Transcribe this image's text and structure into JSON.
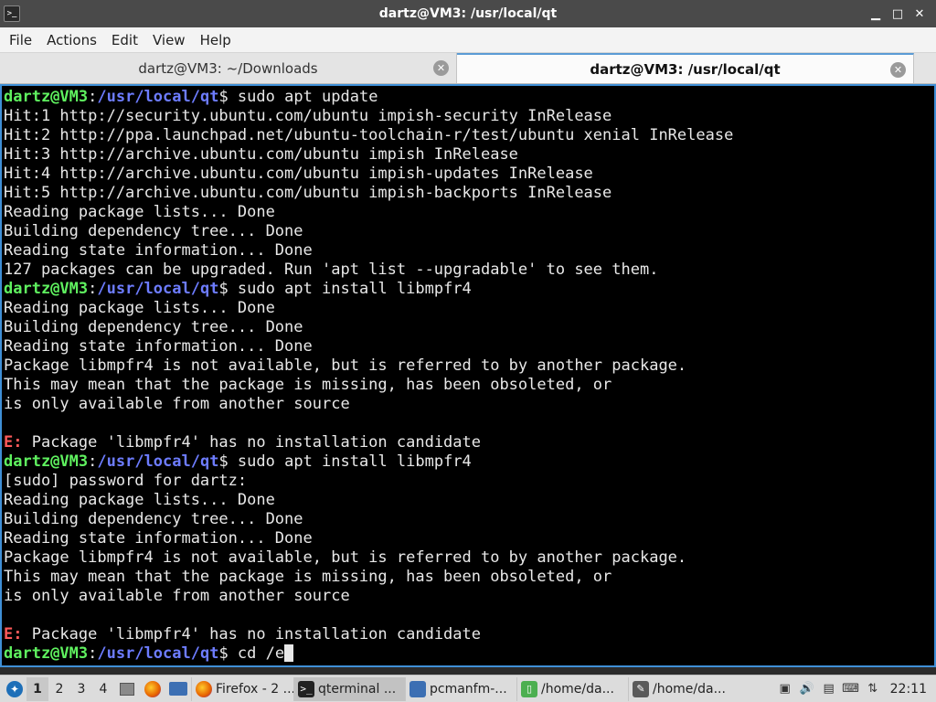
{
  "window": {
    "title": "dartz@VM3: /usr/local/qt",
    "controls": [
      "▁",
      "□",
      "✕"
    ]
  },
  "menu": [
    "File",
    "Actions",
    "Edit",
    "View",
    "Help"
  ],
  "tabs": [
    {
      "label": "dartz@VM3: ~/Downloads",
      "active": false
    },
    {
      "label": "dartz@VM3: /usr/local/qt",
      "active": true
    }
  ],
  "prompt": {
    "user": "dartz@VM3",
    "path": "/usr/local/qt"
  },
  "terminal_lines": [
    {
      "kind": "prompt",
      "cmd": " sudo apt update"
    },
    {
      "kind": "text",
      "text": "Hit:1 http://security.ubuntu.com/ubuntu impish-security InRelease"
    },
    {
      "kind": "text",
      "text": "Hit:2 http://ppa.launchpad.net/ubuntu-toolchain-r/test/ubuntu xenial InRelease"
    },
    {
      "kind": "text",
      "text": "Hit:3 http://archive.ubuntu.com/ubuntu impish InRelease"
    },
    {
      "kind": "text",
      "text": "Hit:4 http://archive.ubuntu.com/ubuntu impish-updates InRelease"
    },
    {
      "kind": "text",
      "text": "Hit:5 http://archive.ubuntu.com/ubuntu impish-backports InRelease"
    },
    {
      "kind": "text",
      "text": "Reading package lists... Done"
    },
    {
      "kind": "text",
      "text": "Building dependency tree... Done"
    },
    {
      "kind": "text",
      "text": "Reading state information... Done"
    },
    {
      "kind": "text",
      "text": "127 packages can be upgraded. Run 'apt list --upgradable' to see them."
    },
    {
      "kind": "prompt",
      "cmd": " sudo apt install libmpfr4"
    },
    {
      "kind": "text",
      "text": "Reading package lists... Done"
    },
    {
      "kind": "text",
      "text": "Building dependency tree... Done"
    },
    {
      "kind": "text",
      "text": "Reading state information... Done"
    },
    {
      "kind": "text",
      "text": "Package libmpfr4 is not available, but is referred to by another package."
    },
    {
      "kind": "text",
      "text": "This may mean that the package is missing, has been obsoleted, or"
    },
    {
      "kind": "text",
      "text": "is only available from another source"
    },
    {
      "kind": "text",
      "text": ""
    },
    {
      "kind": "error",
      "prefix": "E:",
      "text": " Package 'libmpfr4' has no installation candidate"
    },
    {
      "kind": "prompt",
      "cmd": " sudo apt install libmpfr4"
    },
    {
      "kind": "text",
      "text": "[sudo] password for dartz:"
    },
    {
      "kind": "text",
      "text": "Reading package lists... Done"
    },
    {
      "kind": "text",
      "text": "Building dependency tree... Done"
    },
    {
      "kind": "text",
      "text": "Reading state information... Done"
    },
    {
      "kind": "text",
      "text": "Package libmpfr4 is not available, but is referred to by another package."
    },
    {
      "kind": "text",
      "text": "This may mean that the package is missing, has been obsoleted, or"
    },
    {
      "kind": "text",
      "text": "is only available from another source"
    },
    {
      "kind": "text",
      "text": ""
    },
    {
      "kind": "error",
      "prefix": "E:",
      "text": " Package 'libmpfr4' has no installation candidate"
    },
    {
      "kind": "prompt",
      "cmd": " cd /e",
      "cursor": true
    }
  ],
  "taskbar": {
    "workspaces": [
      "1",
      "2",
      "3",
      "4"
    ],
    "active_workspace": "1",
    "tasks": [
      {
        "label": "Firefox - 2 ...",
        "icon": "firefox-icon",
        "color": "#e66000",
        "active": false
      },
      {
        "label": "qterminal ...",
        "icon": "terminal-icon",
        "color": "#222222",
        "active": true
      },
      {
        "label": "pcmanfm-...",
        "icon": "folder-icon",
        "color": "#3c6fb3",
        "active": false
      },
      {
        "label": "/home/da...",
        "icon": "text-editor-icon",
        "color": "#4caf50",
        "active": false
      },
      {
        "label": "/home/da...",
        "icon": "text-editor-icon",
        "color": "#5a5a5a",
        "active": false
      }
    ],
    "clock": "22:11"
  },
  "colors": {
    "prompt_user": "#5ff15f",
    "prompt_path": "#6d7cff",
    "error": "#ff5a5a",
    "terminal_bg": "#000000",
    "terminal_border": "#3f8fd6"
  }
}
